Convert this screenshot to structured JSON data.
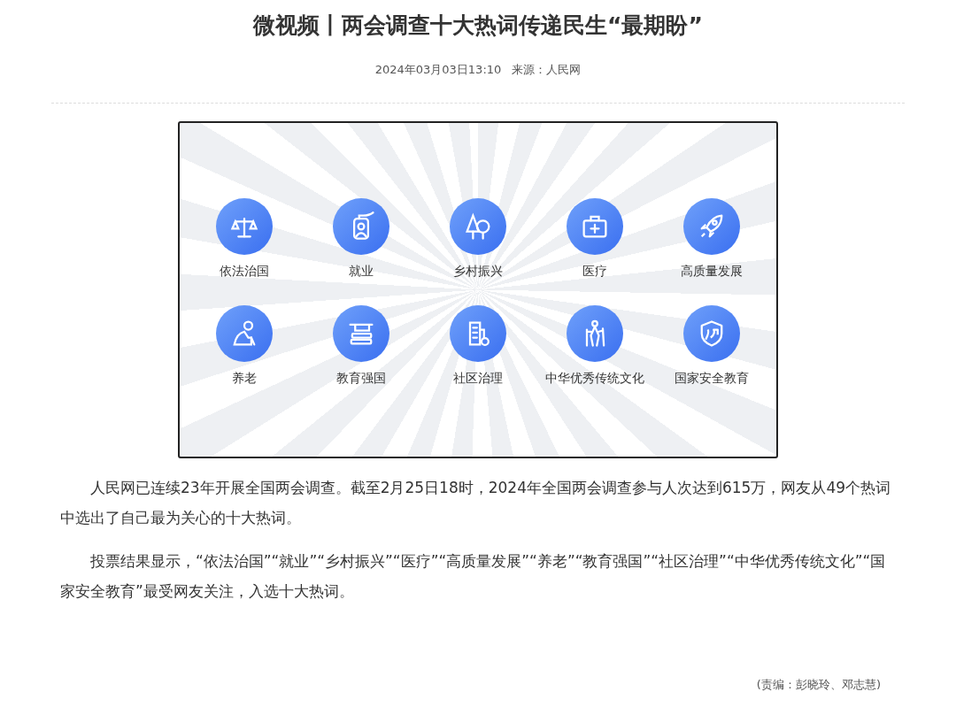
{
  "article": {
    "title": "微视频丨两会调查十大热词传递民生“最期盼”",
    "datetime": "2024年03月03日13:10",
    "source": "来源：人民网",
    "video": {
      "keywords": [
        {
          "label": "依法治国"
        },
        {
          "label": "就业"
        },
        {
          "label": "乡村振兴"
        },
        {
          "label": "医疗"
        },
        {
          "label": "高质量发展"
        },
        {
          "label": "养老"
        },
        {
          "label": "教育强国"
        },
        {
          "label": "社区治理"
        },
        {
          "label": "中华优秀传统文化"
        },
        {
          "label": "国家安全教育"
        }
      ]
    },
    "paragraphs": [
      "人民网已连续23年开展全国两会调查。截至2月25日18时，2024年全国两会调查参与人次达到615万，网友从49个热词中选出了自己最为关心的十大热词。",
      "投票结果显示，“依法治国”“就业”“乡村振兴”“医疗”“高质量发展”“养老”“教育强国”“社区治理”“中华优秀传统文化”“国家安全教育”最受网友关注，入选十大热词。"
    ],
    "editor": "(责编：彭晓玲、邓志慧)"
  }
}
